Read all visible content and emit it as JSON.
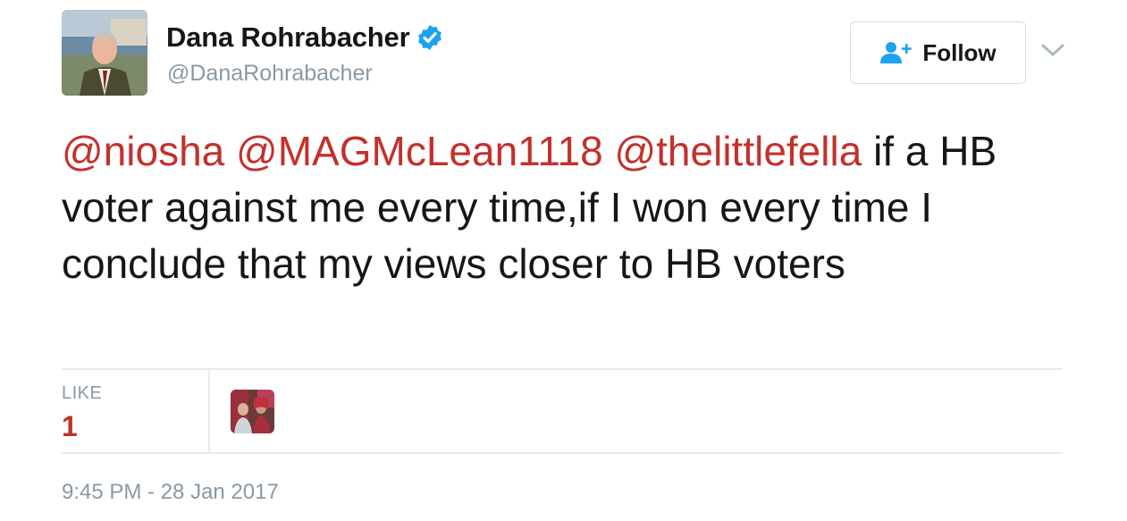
{
  "author": {
    "display_name": "Dana Rohrabacher",
    "handle": "@DanaRohrabacher",
    "verified": true,
    "avatar_icon": "profile-photo"
  },
  "follow_button": {
    "label": "Follow",
    "icon": "add-user-icon"
  },
  "menu_caret_icon": "chevron-down-icon",
  "tweet": {
    "mentions": [
      "@niosha",
      "@MAGMcLean1118",
      "@thelittlefella"
    ],
    "text": " if a HB voter against me every time,if I won every time I conclude that my views closer to HB voters"
  },
  "stats": {
    "like_label": "LIKE",
    "like_count": "1"
  },
  "timestamp": "9:45 PM - 28 Jan 2017",
  "colors": {
    "mention": "#c4302b",
    "verified": "#1da1f2",
    "follow_icon": "#1da1f2",
    "muted": "#8899a6"
  }
}
